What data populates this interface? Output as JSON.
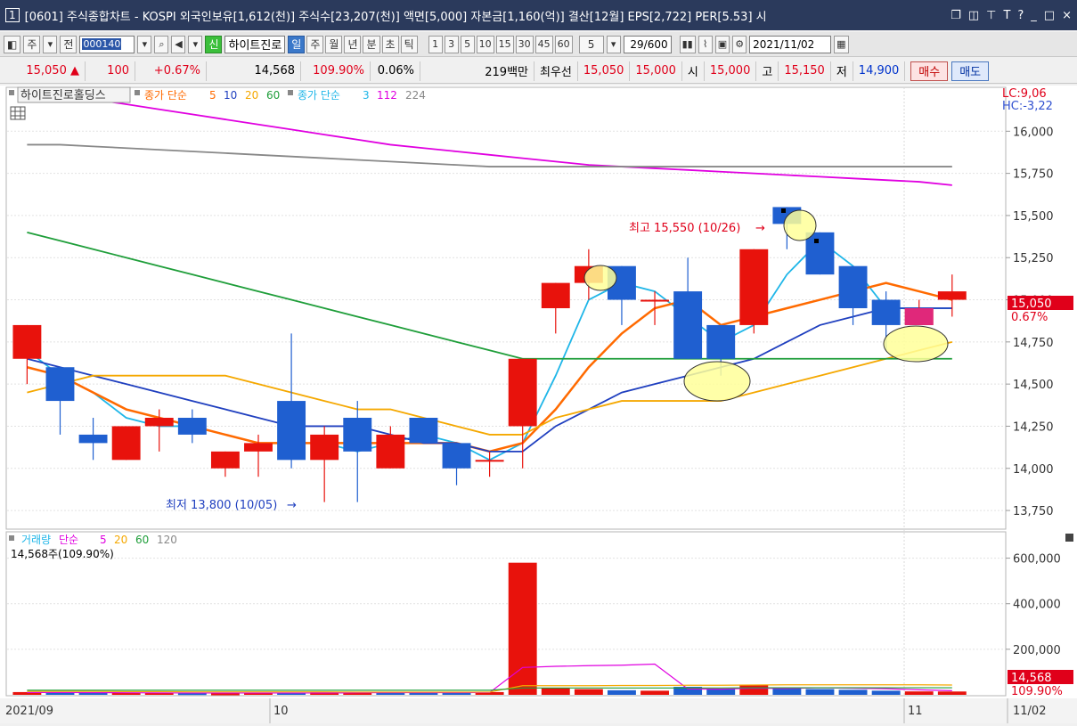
{
  "titlebar": {
    "window_number": "1",
    "title": "[0601] 주식종합차트 - KOSPI 외국인보유[1,612(천)] 주식수[23,207(천)] 액면[5,000] 자본금[1,160(억)] 결산[12월] EPS[2,722] PER[5.53] 시"
  },
  "toolbar": {
    "period_button": "주",
    "prev_button": "전",
    "stock_code": "000140",
    "new_badge": "신",
    "stock_name": "하이트진로",
    "period_tabs": [
      "일",
      "주",
      "월",
      "년",
      "분",
      "초",
      "틱"
    ],
    "active_tab": "일",
    "minute_options": [
      "1",
      "3",
      "5",
      "10",
      "15",
      "30",
      "45",
      "60"
    ],
    "interval_value": "5",
    "count_display": "29/600",
    "date": "2021/11/02"
  },
  "quote": {
    "price": "15,050",
    "change": "100",
    "change_pct": "+0.67%",
    "volume": "14,568",
    "volume_ratio": "109.90%",
    "turnover": "0.06%",
    "amount": "219백만",
    "best_label": "최우선",
    "ask": "15,050",
    "bid": "15,000",
    "open_label": "시",
    "open": "15,000",
    "high_label": "고",
    "high": "15,150",
    "low_label": "저",
    "low": "14,900",
    "buy_label": "매수",
    "sell_label": "매도"
  },
  "price_panel": {
    "stock_label": "하이트진로홀딩스",
    "ma_label1": "종가 단순",
    "ma1_periods": [
      "5",
      "10",
      "20",
      "60"
    ],
    "ma1_colors": [
      "#ff6a00",
      "#1f3fbf",
      "#f5a800",
      "#1f9e3a"
    ],
    "ma_label2": "종가 단순",
    "ma2_periods": [
      "3",
      "112",
      "224"
    ],
    "ma2_colors": [
      "#1fb6e8",
      "#e000e0",
      "#888888"
    ],
    "lc": "LC:9,06",
    "hc": "HC:-3,22",
    "current_price": "15,050",
    "current_pct": "0.67%",
    "high_note": "최고 15,550 (10/26)",
    "low_note": "최저 13,800 (10/05)"
  },
  "volume_panel": {
    "title": "거래량",
    "ma_label": "단순",
    "ma_periods": [
      "5",
      "20",
      "60",
      "120"
    ],
    "ma_colors": [
      "#e000e0",
      "#f5a800",
      "#1f9e3a",
      "#888888"
    ],
    "value_text": "14,568주(109.90%)",
    "current_volume": "14,568",
    "current_pct": "109.90%"
  },
  "date_axis": {
    "labels": [
      "2021/09",
      "10",
      "11",
      "11/02"
    ]
  },
  "chart_data": [
    {
      "type": "candlestick",
      "title": "",
      "ylim": [
        13650,
        16250
      ],
      "yticks": [
        13750,
        14000,
        14250,
        14500,
        14750,
        15000,
        15250,
        15500,
        15750,
        16000
      ],
      "ytick_labels": [
        "13,750",
        "14,000",
        "14,250",
        "14,500",
        "14,750",
        "15,000",
        "15,250",
        "15,500",
        "15,750",
        "16,000"
      ],
      "candles": [
        {
          "o": 14650,
          "h": 14850,
          "l": 14500,
          "c": 14850
        },
        {
          "o": 14600,
          "h": 14600,
          "l": 14200,
          "c": 14400
        },
        {
          "o": 14200,
          "h": 14300,
          "l": 14050,
          "c": 14150
        },
        {
          "o": 14050,
          "h": 14250,
          "l": 14050,
          "c": 14250
        },
        {
          "o": 14250,
          "h": 14350,
          "l": 14100,
          "c": 14300
        },
        {
          "o": 14300,
          "h": 14350,
          "l": 14150,
          "c": 14200
        },
        {
          "o": 14000,
          "h": 14100,
          "l": 13950,
          "c": 14100
        },
        {
          "o": 14100,
          "h": 14200,
          "l": 13950,
          "c": 14150
        },
        {
          "o": 14400,
          "h": 14800,
          "l": 14000,
          "c": 14050
        },
        {
          "o": 14050,
          "h": 14250,
          "l": 13800,
          "c": 14200
        },
        {
          "o": 14300,
          "h": 14400,
          "l": 13800,
          "c": 14100
        },
        {
          "o": 14000,
          "h": 14250,
          "l": 14000,
          "c": 14200
        },
        {
          "o": 14300,
          "h": 14300,
          "l": 14150,
          "c": 14150
        },
        {
          "o": 14150,
          "h": 14150,
          "l": 13900,
          "c": 14000
        },
        {
          "o": 14050,
          "h": 14100,
          "l": 13950,
          "c": 14050
        },
        {
          "o": 14250,
          "h": 14650,
          "l": 14000,
          "c": 14650
        },
        {
          "o": 14950,
          "h": 15100,
          "l": 14800,
          "c": 15100
        },
        {
          "o": 15100,
          "h": 15300,
          "l": 15000,
          "c": 15200
        },
        {
          "o": 15200,
          "h": 15200,
          "l": 14850,
          "c": 15000
        },
        {
          "o": 15000,
          "h": 15050,
          "l": 14850,
          "c": 15000
        },
        {
          "o": 15050,
          "h": 15250,
          "l": 14650,
          "c": 14650
        },
        {
          "o": 14850,
          "h": 14850,
          "l": 14550,
          "c": 14650
        },
        {
          "o": 14850,
          "h": 15300,
          "l": 14800,
          "c": 15300
        },
        {
          "o": 15550,
          "h": 15550,
          "l": 15300,
          "c": 15450
        },
        {
          "o": 15400,
          "h": 15400,
          "l": 15150,
          "c": 15150
        },
        {
          "o": 15200,
          "h": 15200,
          "l": 14850,
          "c": 14950
        },
        {
          "o": 15000,
          "h": 15050,
          "l": 14700,
          "c": 14850
        },
        {
          "o": 14850,
          "h": 15000,
          "l": 14850,
          "c": 14950
        },
        {
          "o": 15000,
          "h": 15150,
          "l": 14900,
          "c": 15050
        }
      ],
      "ma_lines": [
        {
          "name": "3",
          "color": "#1fb6e8",
          "values": [
            14700,
            14550,
            14450,
            14300,
            14250,
            14250,
            14200,
            14150,
            14150,
            14150,
            14100,
            14150,
            14200,
            14150,
            14050,
            14150,
            14550,
            15000,
            15100,
            15050,
            14900,
            14750,
            14850,
            15150,
            15350,
            15200,
            14950,
            14950,
            14950
          ]
        },
        {
          "name": "5",
          "color": "#ff6a00",
          "values": [
            14600,
            14550,
            14450,
            14350,
            14300,
            14250,
            14200,
            14150,
            14150,
            14150,
            14150,
            14150,
            14150,
            14150,
            14100,
            14150,
            14350,
            14600,
            14800,
            14950,
            15000,
            14850,
            14900,
            14950,
            15000,
            15050,
            15100,
            15050,
            15000
          ]
        },
        {
          "name": "10",
          "color": "#1f3fbf",
          "values": [
            14650,
            14600,
            14550,
            14500,
            14450,
            14400,
            14350,
            14300,
            14250,
            14250,
            14250,
            14200,
            14150,
            14150,
            14100,
            14100,
            14250,
            14350,
            14450,
            14500,
            14550,
            14600,
            14650,
            14750,
            14850,
            14900,
            14950,
            14950,
            14950
          ]
        },
        {
          "name": "20",
          "color": "#f5a800",
          "values": [
            14450,
            14500,
            14550,
            14550,
            14550,
            14550,
            14550,
            14500,
            14450,
            14400,
            14350,
            14350,
            14300,
            14250,
            14200,
            14200,
            14300,
            14350,
            14400,
            14400,
            14400,
            14400,
            14450,
            14500,
            14550,
            14600,
            14650,
            14700,
            14750
          ]
        },
        {
          "name": "60",
          "color": "#1f9e3a",
          "values": [
            15400,
            15350,
            15300,
            15250,
            15200,
            15150,
            15100,
            15050,
            15000,
            14950,
            14900,
            14850,
            14800,
            14750,
            14700,
            14650,
            14650,
            14650,
            14650,
            14650,
            14650,
            14650,
            14650,
            14650,
            14650,
            14650,
            14650,
            14650,
            14650
          ]
        },
        {
          "name": "112",
          "color": "#e000e0",
          "values": [
            16250,
            16220,
            16190,
            16160,
            16130,
            16100,
            16070,
            16040,
            16010,
            15980,
            15950,
            15920,
            15900,
            15880,
            15860,
            15840,
            15820,
            15800,
            15790,
            15780,
            15770,
            15760,
            15750,
            15740,
            15730,
            15720,
            15710,
            15700,
            15680
          ]
        },
        {
          "name": "224",
          "color": "#888888",
          "values": [
            15920,
            15920,
            15910,
            15900,
            15890,
            15880,
            15870,
            15860,
            15850,
            15840,
            15830,
            15820,
            15810,
            15800,
            15790,
            15790,
            15790,
            15790,
            15790,
            15790,
            15790,
            15790,
            15790,
            15790,
            15790,
            15790,
            15790,
            15790,
            15790
          ]
        }
      ]
    },
    {
      "type": "bar",
      "title": "거래량",
      "ylim": [
        0,
        700000
      ],
      "yticks": [
        200000,
        400000,
        600000
      ],
      "ytick_labels": [
        "200,000",
        "400,000",
        "600,000"
      ],
      "values": [
        12000,
        10000,
        8000,
        9000,
        8000,
        7000,
        6000,
        8000,
        9000,
        11000,
        10000,
        9000,
        8000,
        9000,
        12000,
        580000,
        30000,
        25000,
        20000,
        18000,
        35000,
        25000,
        45000,
        30000,
        25000,
        22000,
        18000,
        15000,
        14568
      ],
      "up": [
        1,
        0,
        0,
        1,
        1,
        0,
        1,
        1,
        0,
        1,
        1,
        0,
        0,
        0,
        1,
        1,
        1,
        1,
        0,
        1,
        0,
        0,
        1,
        0,
        0,
        0,
        0,
        1,
        1
      ],
      "ma_lines": [
        {
          "name": "5",
          "color": "#e000e0",
          "values": [
            10000,
            10000,
            9500,
            9000,
            8500,
            8000,
            8000,
            8000,
            8000,
            8000,
            9000,
            9500,
            9500,
            9500,
            10000,
            120000,
            125000,
            128000,
            130000,
            135000,
            26000,
            25000,
            29000,
            28000,
            31000,
            29000,
            27000,
            22000,
            18000
          ]
        },
        {
          "name": "20",
          "color": "#f5a800",
          "values": [
            15000,
            15000,
            15000,
            14000,
            14000,
            13000,
            13000,
            13000,
            13000,
            13000,
            12000,
            12000,
            12000,
            12000,
            12000,
            40000,
            40000,
            40000,
            41000,
            41000,
            42000,
            42000,
            43000,
            44000,
            44000,
            44000,
            44000,
            44000,
            43000
          ]
        },
        {
          "name": "60",
          "color": "#1f9e3a",
          "values": [
            20000,
            20000,
            20000,
            20000,
            20000,
            20000,
            20000,
            20000,
            20000,
            20000,
            20000,
            20000,
            20000,
            20000,
            20000,
            30000,
            30000,
            30000,
            30000,
            30000,
            30000,
            30000,
            31000,
            31000,
            31000,
            31000,
            31000,
            31000,
            31000
          ]
        }
      ]
    }
  ]
}
